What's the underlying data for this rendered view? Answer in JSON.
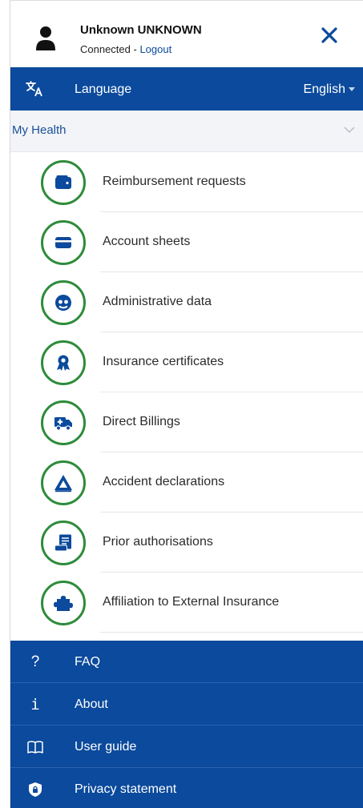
{
  "header": {
    "user_name": "Unknown UNKNOWN",
    "status": "Connected",
    "separator": " - ",
    "logout_label": "Logout"
  },
  "language": {
    "label": "Language",
    "selected": "English"
  },
  "section": {
    "title": "My Health"
  },
  "menu": {
    "items": [
      {
        "label": "Reimbursement requests",
        "icon": "wallet-icon"
      },
      {
        "label": "Account sheets",
        "icon": "credit-card-icon"
      },
      {
        "label": "Administrative data",
        "icon": "user-circle-icon"
      },
      {
        "label": "Insurance certificates",
        "icon": "award-ribbon-icon"
      },
      {
        "label": "Direct Billings",
        "icon": "ambulance-icon"
      },
      {
        "label": "Accident declarations",
        "icon": "warning-triangle-icon"
      },
      {
        "label": "Prior authorisations",
        "icon": "scroll-document-icon"
      },
      {
        "label": "Affiliation to External Insurance",
        "icon": "puzzle-piece-icon"
      }
    ]
  },
  "bottom_nav": {
    "items": [
      {
        "label": "FAQ",
        "icon": "question-icon"
      },
      {
        "label": "About",
        "icon": "info-icon"
      },
      {
        "label": "User guide",
        "icon": "book-icon"
      },
      {
        "label": "Privacy statement",
        "icon": "shield-lock-icon"
      }
    ]
  },
  "colors": {
    "primary": "#0b4a9c",
    "accent_green": "#2e8b3a",
    "link": "#0b4aa0",
    "section_bg": "#f2f4f8"
  }
}
